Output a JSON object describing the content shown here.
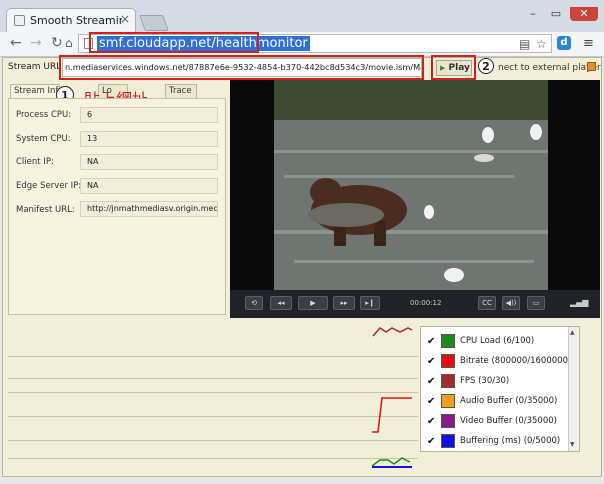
{
  "browser": {
    "tab_title": "Smooth Streaming Health",
    "close_glyph": "×",
    "address": "smf.cloudapp.net/healthmonitor",
    "window_buttons": [
      "–",
      "▭",
      "✕"
    ]
  },
  "toolbar": {
    "label": "Stream URL:",
    "url_value": "n.mediaservices.windows.net/87887e6e-9532-4854-b370-442bc8d534c3/movie.ism/Manifest",
    "play_label": "Play",
    "connect_label": "nect to external player"
  },
  "annotations": {
    "step1": "1",
    "step2": "2",
    "step1_text": "貼上網址"
  },
  "panel": {
    "tabs": [
      "Stream Inf",
      "Lo",
      "Trace"
    ],
    "rows": [
      {
        "label": "Process CPU:",
        "value": "6"
      },
      {
        "label": "System CPU:",
        "value": "13"
      },
      {
        "label": "Client IP:",
        "value": "NA"
      },
      {
        "label": "Edge Server IP:",
        "value": "NA"
      },
      {
        "label": "Manifest URL:",
        "value": "http://jnmathmediasv.origin.medi"
      }
    ]
  },
  "player": {
    "time": "00:00:12",
    "buttons": [
      "⟲",
      "◂◂",
      "▶",
      "▸▸",
      "▸❙",
      "CC",
      "◀))",
      "▭",
      "▂▄▆"
    ]
  },
  "legend": {
    "items": [
      {
        "label": "CPU Load (6/100)",
        "color": "#1a8a1a"
      },
      {
        "label": "Bitrate (800000/1600000)",
        "color": "#e01010"
      },
      {
        "label": "FPS (30/30)",
        "color": "#a52a2a"
      },
      {
        "label": "Audio Buffer (0/35000)",
        "color": "#f0a020"
      },
      {
        "label": "Video Buffer (0/35000)",
        "color": "#8a1a8a"
      },
      {
        "label": "Buffering (ms) (0/5000)",
        "color": "#1010e0"
      }
    ],
    "check": "✔"
  }
}
